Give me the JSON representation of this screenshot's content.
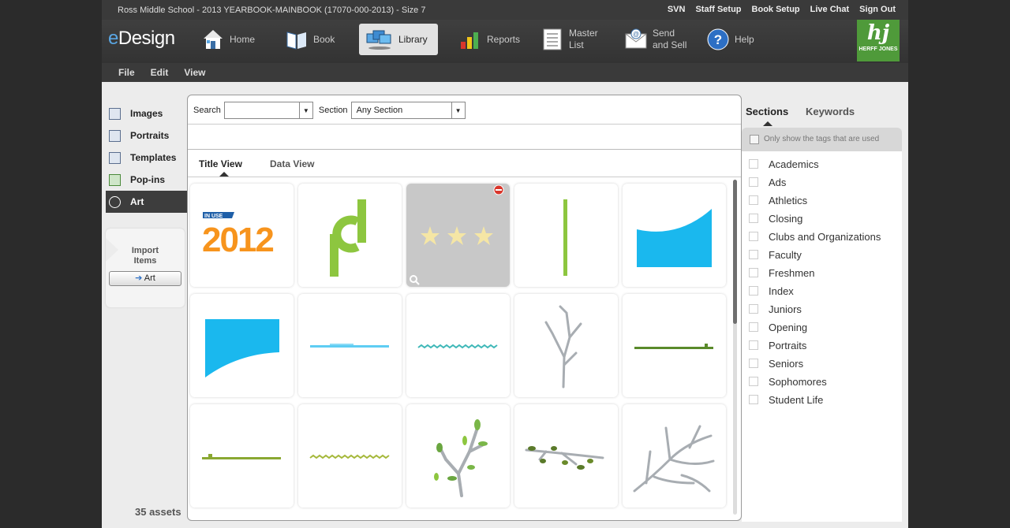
{
  "topbar": {
    "title": "Ross Middle School -  2013 YEARBOOK-MAINBOOK (17070-000-2013) - Size 7",
    "links": [
      "SVN",
      "Staff Setup",
      "Book Setup",
      "Live Chat",
      "Sign Out"
    ]
  },
  "nav": {
    "logo_prefix": "e",
    "logo_suffix": "Design",
    "home": "Home",
    "book": "Book",
    "library": "Library",
    "reports": "Reports",
    "master_1": "Master",
    "master_2": "List",
    "send_1": "Send",
    "send_2": "and Sell",
    "help": "Help",
    "brand": "HERFF JONES",
    "active": "library"
  },
  "menu": [
    "File",
    "Edit",
    "View"
  ],
  "sidebar": {
    "items": [
      "Images",
      "Portraits",
      "Templates",
      "Pop-ins",
      "Art"
    ],
    "active": "Art",
    "import_1": "Import",
    "import_2": "Items",
    "art_button": "Art",
    "asset_count": "35 assets"
  },
  "search": {
    "search_label": "Search",
    "search_value": "",
    "section_label": "Section",
    "section_value": "Any Section"
  },
  "views": {
    "title_view": "Title View",
    "data_view": "Data View",
    "active": "Title View"
  },
  "grid": {
    "items": [
      {
        "name": "in-use-2012",
        "badge": "IN USE",
        "text": "2012"
      },
      {
        "name": "green-d-shape"
      },
      {
        "name": "three-stars",
        "selected": true
      },
      {
        "name": "green-vertical-line"
      },
      {
        "name": "blue-curve-shape"
      },
      {
        "name": "blue-curve-shape-2"
      },
      {
        "name": "blue-line"
      },
      {
        "name": "teal-zigzag-line"
      },
      {
        "name": "gray-tree"
      },
      {
        "name": "green-line-right"
      },
      {
        "name": "green-line-left"
      },
      {
        "name": "green-zigzag-line"
      },
      {
        "name": "tree-branch-leaves"
      },
      {
        "name": "branch-leaves-horizontal"
      },
      {
        "name": "gray-branches"
      }
    ]
  },
  "right": {
    "tab_sections": "Sections",
    "tab_keywords": "Keywords",
    "only_used": "Only show the tags that are used",
    "tags": [
      "Academics",
      "Ads",
      "Athletics",
      "Closing",
      "Clubs and Organizations",
      "Faculty",
      "Freshmen",
      "Index",
      "Juniors",
      "Opening",
      "Portraits",
      "Seniors",
      "Sophomores",
      "Student Life"
    ]
  },
  "colors": {
    "accent_blue": "#1ab8ee",
    "accent_green": "#8dc63f",
    "orange": "#f7941d",
    "brand_green": "#4f9a3a",
    "tree_gray": "#a8adb2",
    "star": "#f5e6a5"
  }
}
